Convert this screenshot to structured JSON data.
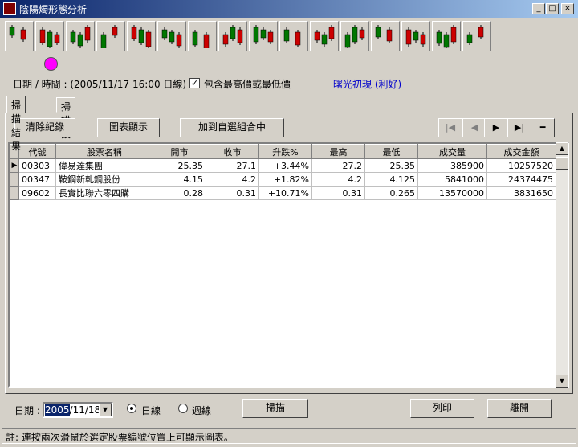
{
  "window": {
    "title": "陰陽燭形態分析",
    "minimize": "_",
    "maximize": "□",
    "close": "×"
  },
  "toolbar_count": 16,
  "info": {
    "datetime": "日期 / 時間 : (2005/11/17 16:00  日線)",
    "checkbox_label": "包含最高價或最低價",
    "checkbox_checked": "✓",
    "pattern_name": "曙光初現 (利好)",
    "pattern_color": "#0000cc"
  },
  "tabs": [
    {
      "label": "掃描結果"
    },
    {
      "label": "掃描設定"
    }
  ],
  "buttons": {
    "clear": "清除紀錄",
    "chart": "圖表顯示",
    "add_portfolio": "加到自選組合中"
  },
  "nav": {
    "first": "|◀",
    "prev": "◀",
    "next": "▶",
    "last": "▶|",
    "minus": "━"
  },
  "table": {
    "headers": [
      "代號",
      "股票名稱",
      "開市",
      "收市",
      "升跌%",
      "最高",
      "最低",
      "成交量",
      "成交金額"
    ],
    "rows": [
      [
        "00303",
        "偉易達集團",
        "25.35",
        "27.1",
        "+3.44%",
        "27.2",
        "25.35",
        "385900",
        "10257520"
      ],
      [
        "00347",
        "鞍鋼新軋鋼股份",
        "4.15",
        "4.2",
        "+1.82%",
        "4.2",
        "4.125",
        "5841000",
        "24374475"
      ],
      [
        "09602",
        "長實比聯六零四購",
        "0.28",
        "0.31",
        "+10.71%",
        "0.31",
        "0.265",
        "13570000",
        "3831650"
      ]
    ]
  },
  "bottom": {
    "date_label": "日期 :",
    "date_selected": "2005",
    "date_rest": "/11/18",
    "radio_daily": "日線",
    "radio_weekly": "週線",
    "scan": "掃描",
    "print": "列印",
    "exit": "離開"
  },
  "status": "註: 連按兩次滑鼠於選定股票編號位置上可顯示圖表。",
  "colors": {
    "up": "#cc0000",
    "down": "#007700",
    "marker": "#ff00ff",
    "selected": "#0a246a"
  }
}
